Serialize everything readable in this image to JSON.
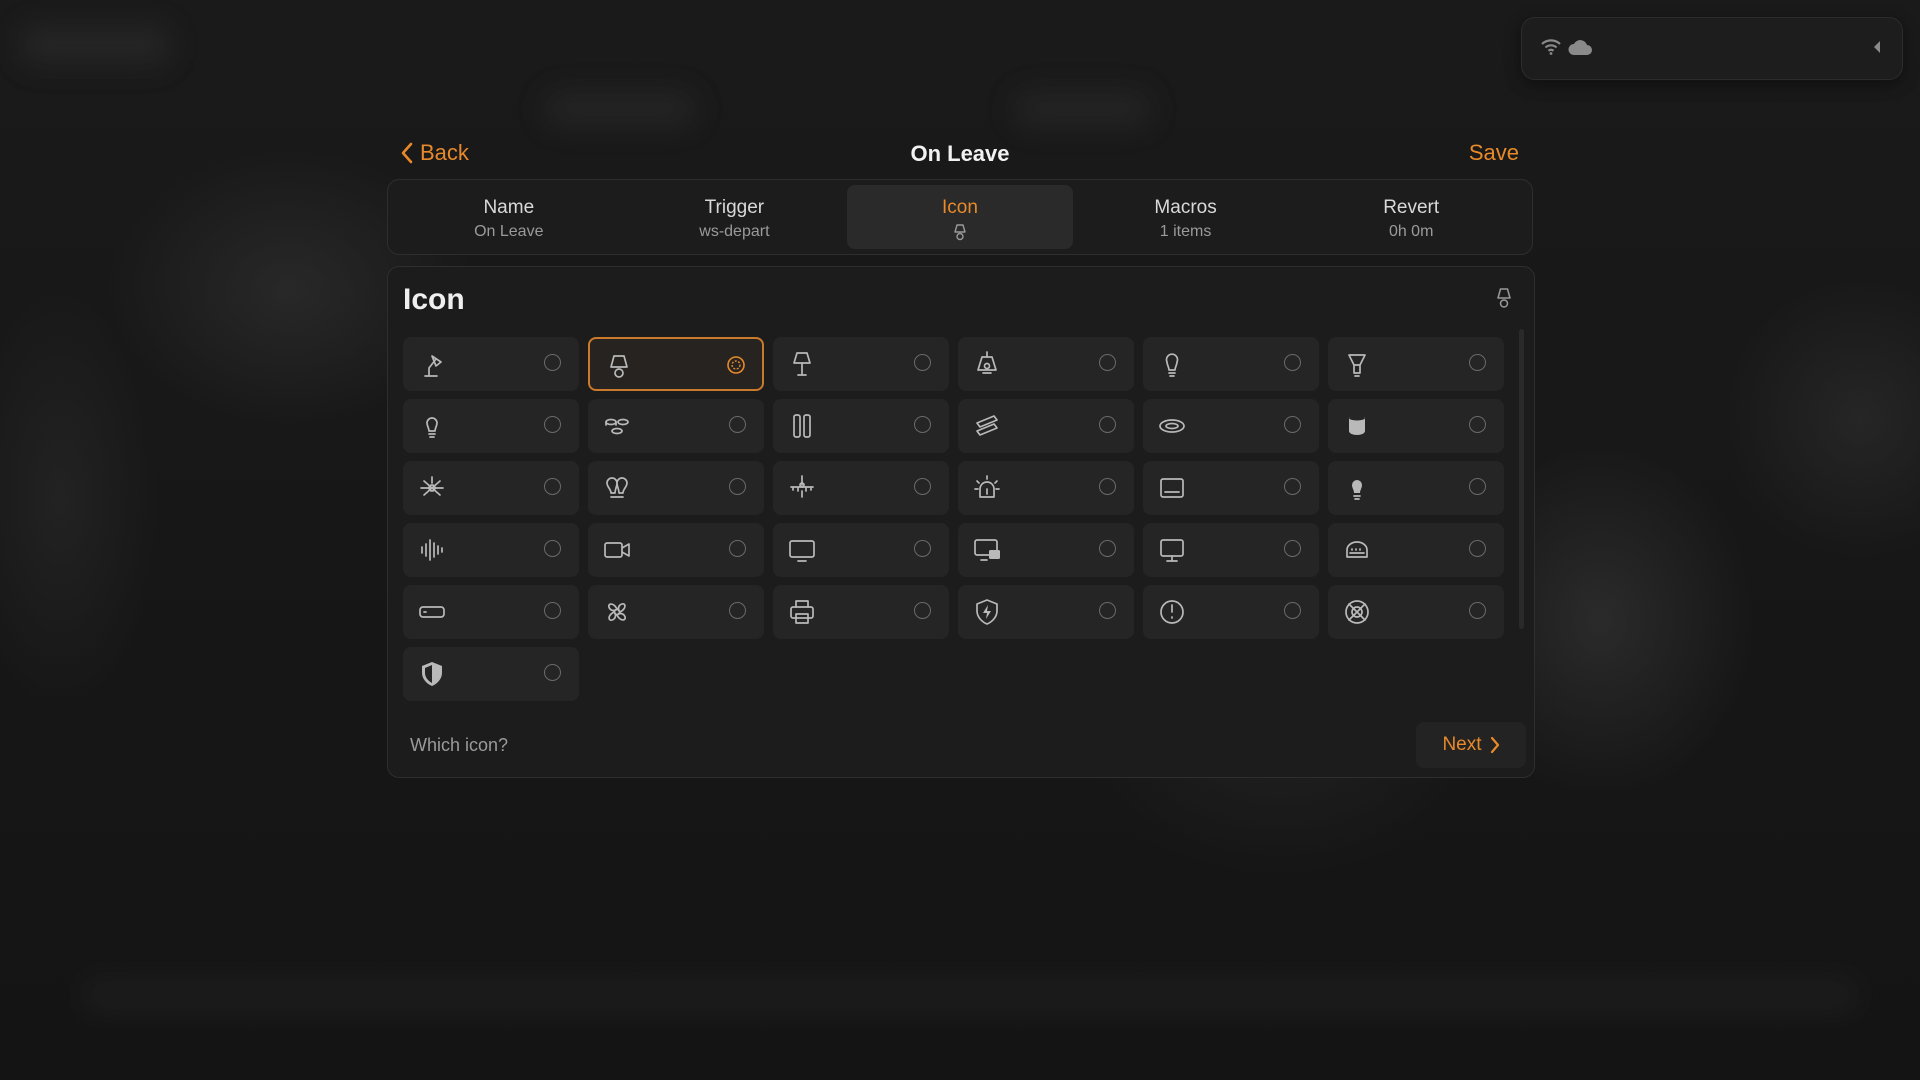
{
  "header": {
    "back_label": "Back",
    "title": "On Leave",
    "save_label": "Save"
  },
  "tabs": [
    {
      "label": "Name",
      "sub": "On Leave"
    },
    {
      "label": "Trigger",
      "sub": "ws-depart"
    },
    {
      "label": "Icon",
      "sub_icon": "lamp-icon"
    },
    {
      "label": "Macros",
      "sub": "1 items"
    },
    {
      "label": "Revert",
      "sub": "0h 0m"
    }
  ],
  "panel": {
    "title": "Icon",
    "header_icon": "lamp-icon",
    "hint": "Which icon?",
    "next_label": "Next",
    "selected_icon": "lamp-icon",
    "icons": [
      "desk-lamp-icon",
      "lamp-icon",
      "floor-lamp-icon",
      "pendant-lamp-icon",
      "light-bulb-icon",
      "spotlight-icon",
      "bulb-icon",
      "ceiling-spots-icon",
      "light-panel-icon",
      "light-strip-icon",
      "recessed-light-icon",
      "downlight-icon",
      "ceiling-fan-light-icon",
      "double-bulb-icon",
      "chandelier-icon",
      "sunrise-light-icon",
      "wall-panel-icon",
      "solid-bulb-icon",
      "soundwave-icon",
      "video-camera-icon",
      "tv-icon",
      "desktop-combo-icon",
      "monitor-icon",
      "router-icon",
      "soundbar-icon",
      "fan-icon",
      "printer-icon",
      "security-bolt-icon",
      "gauge-icon",
      "blocked-sensor-icon",
      "shield-icon"
    ]
  },
  "colors": {
    "accent": "#e8892a",
    "selected_border": "#c97a2b"
  }
}
